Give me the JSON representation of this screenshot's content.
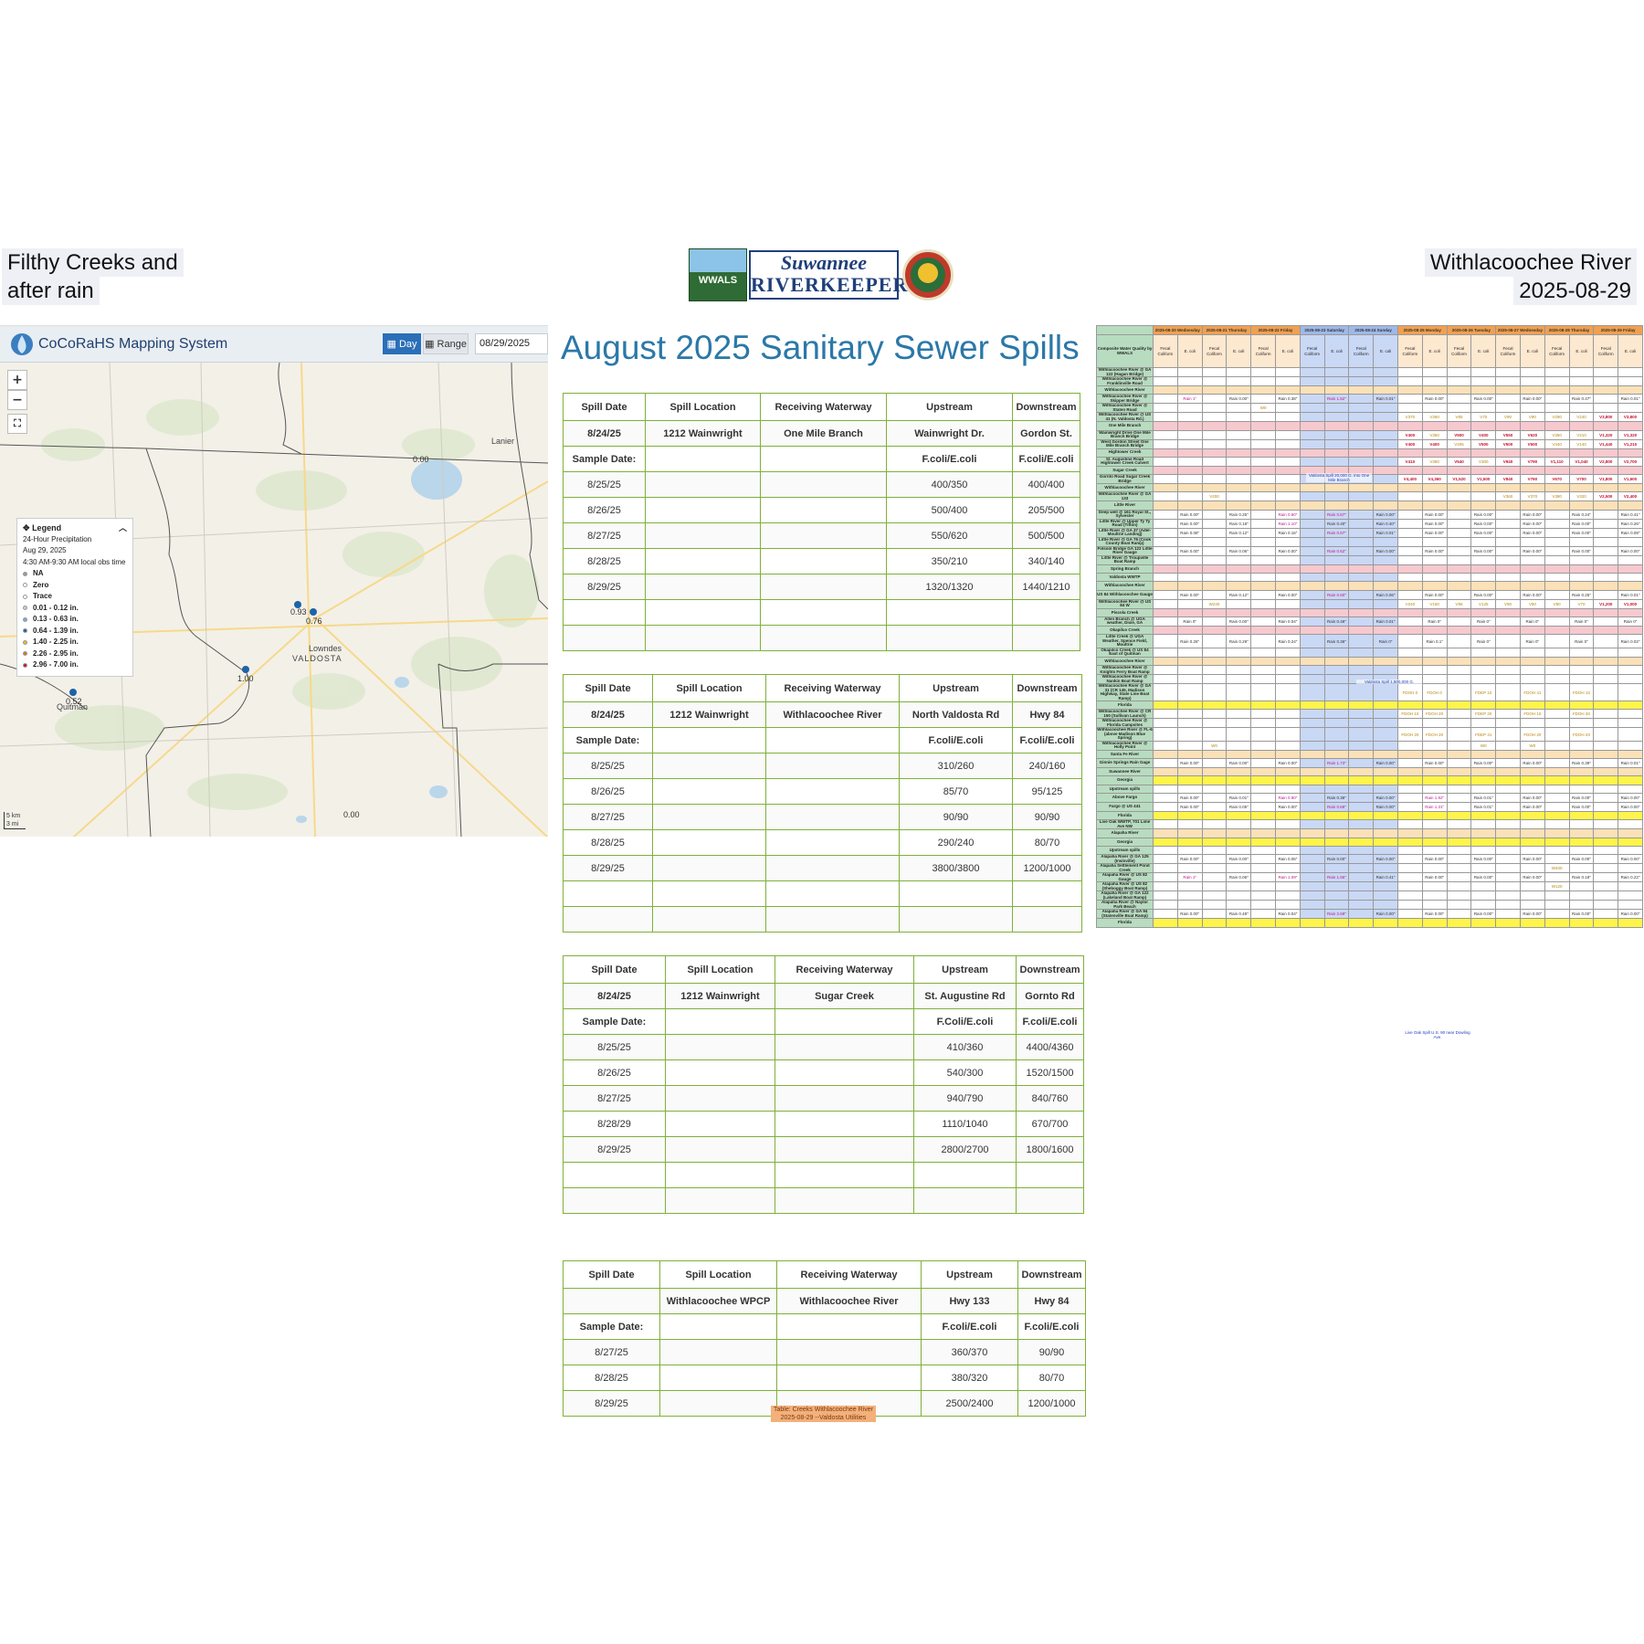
{
  "title_left": {
    "line1": "Filthy Creeks and",
    "line2": "after rain"
  },
  "title_right": {
    "line1": "Withlacoochee River",
    "line2": "2025-08-29"
  },
  "logos": {
    "wwals": "WWALS",
    "srk_line1": "Suwannee",
    "srk_line2": "RIVERKEEPER"
  },
  "map": {
    "app_title": "CoCoRaHS Mapping System",
    "day_label": "Day",
    "range_label": "Range",
    "date": "08/29/2025",
    "zoom_in": "+",
    "zoom_out": "−",
    "legend": {
      "title": "Legend",
      "subtitle": "24-Hour Precipitation",
      "date": "Aug 29, 2025",
      "time": "4:30 AM-9:30 AM local obs time",
      "items": [
        {
          "label": "NA",
          "color": "#999999"
        },
        {
          "label": "Zero",
          "color": "#ffffff"
        },
        {
          "label": "Trace",
          "color": "#ffffff"
        },
        {
          "label": "0.01 - 0.12 in.",
          "color": "#cccccc"
        },
        {
          "label": "0.13 - 0.63 in.",
          "color": "#6aaee8"
        },
        {
          "label": "0.64 - 1.39 in.",
          "color": "#1d63a8"
        },
        {
          "label": "1.40 - 2.25 in.",
          "color": "#e0c020"
        },
        {
          "label": "2.26 - 2.95 in.",
          "color": "#e07020"
        },
        {
          "label": "2.96 - 7.00 in.",
          "color": "#d01818"
        }
      ]
    },
    "places": {
      "lanier": "Lanier",
      "lowndes": "Lowndes",
      "valdosta": "VALDOSTA",
      "quitman": "Quitman"
    },
    "values": [
      "0.00",
      "0.93",
      "0.76",
      "1.00",
      "0.52",
      "0.00"
    ],
    "scale": {
      "km": "5 km",
      "mi": "3 mi"
    }
  },
  "main_title": "August 2025 Sanitary Sewer Spills",
  "headers": [
    "Spill Date",
    "Spill Location",
    "Receiving Waterway",
    "Upstream",
    "Downstream"
  ],
  "sample_label": "Sample Date:",
  "spills": [
    {
      "info": [
        "8/24/25",
        "1212 Wainwright",
        "One Mile Branch",
        "Wainwright Dr.",
        "Gordon St."
      ],
      "units": [
        "F.coli/E.coli",
        "F.coli/E.coli"
      ],
      "rows": [
        [
          "8/25/25",
          "400/350",
          "400/400"
        ],
        [
          "8/26/25",
          "500/400",
          "205/500"
        ],
        [
          "8/27/25",
          "550/620",
          "500/500"
        ],
        [
          "8/28/25",
          "350/210",
          "340/140"
        ],
        [
          "8/29/25",
          "1320/1320",
          "1440/1210"
        ]
      ],
      "blank": 2
    },
    {
      "info": [
        "8/24/25",
        "1212 Wainwright",
        "Withlacoochee River",
        "North Valdosta Rd",
        "Hwy 84"
      ],
      "units": [
        "F.coli/E.coli",
        "F.coli/E.coli"
      ],
      "rows": [
        [
          "8/25/25",
          "310/260",
          "240/160"
        ],
        [
          "8/26/25",
          "85/70",
          "95/125"
        ],
        [
          "8/27/25",
          "90/90",
          "90/90"
        ],
        [
          "8/28/25",
          "290/240",
          "80/70"
        ],
        [
          "8/29/25",
          "3800/3800",
          "1200/1000"
        ]
      ],
      "blank": 2
    },
    {
      "info": [
        "8/24/25",
        "1212 Wainwright",
        "Sugar Creek",
        "St. Augustine Rd",
        "Gornto Rd"
      ],
      "units": [
        "F.Coli/E.coli",
        "F.coli/E.coli"
      ],
      "rows": [
        [
          "8/25/25",
          "410/360",
          "4400/4360"
        ],
        [
          "8/26/25",
          "540/300",
          "1520/1500"
        ],
        [
          "8/27/25",
          "940/790",
          "840/760"
        ],
        [
          "8/28/29",
          "1110/1040",
          "670/700"
        ],
        [
          "8/29/25",
          "2800/2700",
          "1800/1600"
        ]
      ],
      "blank": 2
    },
    {
      "info": [
        "",
        "Withlacoochee WPCP",
        "Withlacoochee River",
        "Hwy 133",
        "Hwy 84"
      ],
      "units": [
        "F.coli/E.coli",
        "F.coli/E.coli"
      ],
      "rows": [
        [
          "8/27/25",
          "360/370",
          "90/90"
        ],
        [
          "8/28/25",
          "380/320",
          "80/70"
        ],
        [
          "8/29/25",
          "2500/2400",
          "1200/1000"
        ]
      ],
      "blank": 0
    }
  ],
  "caption": {
    "line1": "Table: Creeks Withlacoochee River",
    "line2": "2025-08-29 --Valdosta Utilities"
  },
  "sheet": {
    "dates": [
      "2025-08-20",
      "2025-08-21",
      "2025-08-22",
      "2025-08-23",
      "2025-08-24",
      "2025-08-25",
      "2025-08-26",
      "2025-08-27",
      "2025-08-28",
      "2025-08-29"
    ],
    "days": [
      "Wednesday",
      "Thursday",
      "Friday",
      "Saturday",
      "Sunday",
      "Monday",
      "Tuesday",
      "Wednesday",
      "Thursday",
      "Friday"
    ],
    "corner": "Composite Water Quality by WWALS",
    "fecal": "Fecal Coliform",
    "ecoli": "E. coli",
    "rows": [
      {
        "loc": "Withlacoochee River @ GA 122 (Hagan Bridge)",
        "cls": ""
      },
      {
        "loc": "Withlacoochee River @ Franklinville Road",
        "cls": ""
      },
      {
        "loc": "Withlacoochee River",
        "cls": "r-tan"
      },
      {
        "loc": "Withlacoochee River @ Skipper Bridge",
        "cls": "",
        "v": {
          "1": "Rain 1\"",
          "3": "Rain 0.00\"",
          "5": "Rain 0.38\"",
          "7": "Rain 1.52\"",
          "9": "Rain 0.01\"",
          "11": "Rain 0.00\"",
          "13": "Rain 0.00\"",
          "15": "Rain 0.00\"",
          "17": "Rain 0.47\"",
          "19": "Rain 0.01\""
        }
      },
      {
        "loc": "Withlacoochee River @ Staten Road",
        "cls": "",
        "v": {
          "4": "W0"
        }
      },
      {
        "loc": "Withlacoochee River @ US 41 (N. Valdosta Rd.)",
        "cls": "",
        "v": {
          "10": "V370",
          "11": "V260",
          "12": "V85",
          "13": "V70",
          "14": "V90",
          "15": "V90",
          "16": "V290",
          "17": "V240",
          "18": "V3,800",
          "19": "V3,800"
        }
      },
      {
        "loc": "One Mile Branch",
        "cls": "r-pink"
      },
      {
        "loc": "Wainwright Drive One Mile Branch Bridge",
        "cls": "",
        "v": {
          "10": "V400",
          "11": "V350",
          "12": "V500",
          "13": "V400",
          "14": "V550",
          "15": "V620",
          "16": "V350",
          "17": "V210",
          "18": "V1,320",
          "19": "V1,320"
        }
      },
      {
        "loc": "West Gordon Street One Mile Branch Bridge",
        "cls": "",
        "v": {
          "10": "V400",
          "11": "V400",
          "12": "V205",
          "13": "V500",
          "14": "V500",
          "15": "V500",
          "16": "V340",
          "17": "V140",
          "18": "V1,440",
          "19": "V1,210"
        }
      },
      {
        "loc": "Hightower Creek",
        "cls": "r-pink"
      },
      {
        "loc": "St. Augustine Road Hightower Creek Culvert",
        "cls": "",
        "v": {
          "10": "V410",
          "11": "V360",
          "12": "V540",
          "13": "V300",
          "14": "V940",
          "15": "V790",
          "16": "V1,110",
          "17": "V1,040",
          "18": "V2,800",
          "19": "V2,700"
        }
      },
      {
        "loc": "Sugar Creek",
        "cls": "r-pink"
      },
      {
        "loc": "Gornto Road Sugar Creek Bridge",
        "cls": "",
        "v": {
          "10": "V4,400",
          "11": "V4,360",
          "12": "V1,520",
          "13": "V1,500",
          "14": "V840",
          "15": "V760",
          "16": "V670",
          "17": "V700",
          "18": "V1,800",
          "19": "V1,600"
        }
      },
      {
        "loc": "Withlacoochee River",
        "cls": "r-tan"
      },
      {
        "loc": "Withlacoochee River @ GA 133",
        "cls": "",
        "v": {
          "2": "V200",
          "14": "V360",
          "15": "V370",
          "16": "V380",
          "17": "V320",
          "18": "V2,500",
          "19": "V2,400"
        }
      },
      {
        "loc": "Little River",
        "cls": "r-tan"
      },
      {
        "loc": "Deep well @ 161 Royal St., Sylvester",
        "cls": "",
        "v": {
          "1": "Rain 0.00\"",
          "3": "Rain 0.25\"",
          "5": "Rain 0.60\"",
          "7": "Rain 0.67\"",
          "9": "Rain 0.00\"",
          "11": "Rain 0.00\"",
          "13": "Rain 0.00\"",
          "15": "Rain 0.00\"",
          "17": "Rain 0.24\"",
          "19": "Rain 0.41\""
        }
      },
      {
        "loc": "Little River @ Upper Ty Ty Road (Tifton)",
        "cls": "",
        "v": {
          "1": "Rain 0.00\"",
          "3": "Rain 0.18\"",
          "5": "Rain 1.10\"",
          "7": "Rain 0.40\"",
          "9": "Rain 0.40\"",
          "11": "Rain 0.00\"",
          "13": "Rain 0.00\"",
          "15": "Rain 0.00\"",
          "17": "Rain 0.00\"",
          "19": "Rain 0.26\""
        }
      },
      {
        "loc": "Little River @ GA 37 (Adel-Moultrie Landing)",
        "cls": "",
        "v": {
          "1": "Rain 0.08\"",
          "3": "Rain 0.12\"",
          "5": "Rain 0.16\"",
          "7": "Rain 0.67\"",
          "9": "Rain 0.01\"",
          "11": "Rain 0.00\"",
          "13": "Rain 0.00\"",
          "15": "Rain 0.00\"",
          "17": "Rain 0.00\"",
          "19": "Rain 0.08\""
        }
      },
      {
        "loc": "Little River @ GA 76 (Cook County Boat Ramp)",
        "cls": ""
      },
      {
        "loc": "Folsom Bridge GA 122 Little River Gauge",
        "cls": "",
        "v": {
          "1": "Rain 0.00\"",
          "3": "Rain 0.06\"",
          "5": "Rain 0.00\"",
          "7": "Rain 0.62\"",
          "9": "Rain 0.00\"",
          "11": "Rain 0.00\"",
          "13": "Rain 0.00\"",
          "15": "Rain 0.00\"",
          "17": "Rain 0.00\"",
          "19": "Rain 0.00\""
        }
      },
      {
        "loc": "Little River @ Troupville Boat Ramp",
        "cls": ""
      },
      {
        "loc": "Spring Branch",
        "cls": "r-pink"
      },
      {
        "loc": "Valdosta WWTP",
        "cls": ""
      },
      {
        "loc": "Withlacoochee River",
        "cls": "r-tan"
      },
      {
        "loc": "US 84 Withlacoochee Gauge",
        "cls": "",
        "v": {
          "1": "Rain 0.00\"",
          "3": "Rain 0.12\"",
          "5": "Rain 0.00\"",
          "7": "Rain 0.60\"",
          "9": "Rain 0.06\"",
          "11": "Rain 0.00\"",
          "13": "Rain 0.00\"",
          "15": "Rain 0.00\"",
          "17": "Rain 0.25\"",
          "19": "Rain 0.01\""
        }
      },
      {
        "loc": "Withlacoochee River @ US 84 W",
        "cls": "",
        "v": {
          "2": "W240",
          "10": "V240",
          "11": "V160",
          "12": "V95",
          "13": "V125",
          "14": "V90",
          "15": "V90",
          "16": "V80",
          "17": "V70",
          "18": "V1,200",
          "19": "V1,000"
        }
      },
      {
        "loc": "Piscola Creek",
        "cls": "r-pink"
      },
      {
        "loc": "Allen Branch @ UGA weather, Dixie, GA",
        "cls": "",
        "v": {
          "1": "Rain 0\"",
          "3": "Rain 0.00\"",
          "5": "Rain 0.04\"",
          "7": "Rain 0.46\"",
          "9": "Rain 0.01\"",
          "11": "Rain 0\"",
          "13": "Rain 0\"",
          "15": "Rain 0\"",
          "17": "Rain 0\"",
          "19": "Rain 0\""
        }
      },
      {
        "loc": "Okapilco Creek",
        "cls": "r-pink"
      },
      {
        "loc": "Little Creek @ UGA Weather, Spence Field, Moultrie",
        "cls": "",
        "v": {
          "1": "Rain 0.26\"",
          "3": "Rain 0.29\"",
          "5": "Rain 0.24\"",
          "7": "Rain 0.36\"",
          "9": "Rain 0\"",
          "11": "Rain 0.1\"",
          "13": "Rain 0\"",
          "15": "Rain 0\"",
          "17": "Rain 0\"",
          "19": "Rain 0.02\""
        }
      },
      {
        "loc": "Okapilco Creek @ US 84 East of Quitman",
        "cls": ""
      },
      {
        "loc": "Withlacoochee River",
        "cls": "r-tan"
      },
      {
        "loc": "Withlacoochee River @ Knights Ferry Boat Ramp",
        "cls": ""
      },
      {
        "loc": "Withlacoochee River @ Nankin Boat Ramp",
        "cls": ""
      },
      {
        "loc": "Withlacoochee River @ GA 31 (CR 145, Madison Highway, State Line Boat Ramp)",
        "cls": "",
        "v": {
          "10": "FDOH 0",
          "11": "FDOH 0",
          "13": "FDEP 10",
          "15": "FDOH 41",
          "17": "FDOH 10"
        }
      },
      {
        "loc": "Florida",
        "cls": "r-yellow"
      },
      {
        "loc": "Withlacoochee River @ CR 150 (Sullivan Launch)",
        "cls": "",
        "v": {
          "10": "FDOH 10",
          "11": "FDOH 20",
          "13": "FDEP 20",
          "15": "FDOH 10",
          "17": "FDOH 30"
        }
      },
      {
        "loc": "Withlacoochee River @ Florida Campsites",
        "cls": ""
      },
      {
        "loc": "Withlacoochee River @ FL-6 (above Madison Blue Spring)",
        "cls": "",
        "v": {
          "10": "FDOH 20",
          "11": "FDOH 20",
          "13": "FDEP 31",
          "15": "FDOH 20",
          "17": "FDOH 20"
        }
      },
      {
        "loc": "Withlacoochee River @ Holly Point",
        "cls": "",
        "v": {
          "2": "W0",
          "13": "W0",
          "15": "W0"
        }
      },
      {
        "loc": "Santa Fe River",
        "cls": "r-tan"
      },
      {
        "loc": "Ginnie Springs Rain Gage",
        "cls": "",
        "v": {
          "1": "Rain 0.00\"",
          "3": "Rain 0.00\"",
          "5": "Rain 0.00\"",
          "7": "Rain 1.73\"",
          "9": "Rain 0.00\"",
          "11": "Rain 0.00\"",
          "13": "Rain 0.00\"",
          "15": "Rain 0.00\"",
          "17": "Rain 0.39\"",
          "19": "Rain 0.01\""
        }
      },
      {
        "loc": "Suwannee River",
        "cls": "r-tan"
      },
      {
        "loc": "Georgia",
        "cls": "r-yellow"
      },
      {
        "loc": "Upstream spills",
        "cls": ""
      },
      {
        "loc": "Above Fargo",
        "cls": "",
        "v": {
          "1": "Rain 0.00\"",
          "3": "Rain 0.01\"",
          "5": "Rain 0.90\"",
          "7": "Rain 0.36\"",
          "9": "Rain 0.00\"",
          "11": "Rain 1.92\"",
          "13": "Rain 0.01\"",
          "15": "Rain 0.00\"",
          "17": "Rain 0.00\"",
          "19": "Rain 0.00\""
        }
      },
      {
        "loc": "Fargo @ US 441",
        "cls": "",
        "v": {
          "1": "Rain 0.00\"",
          "3": "Rain 0.05\"",
          "5": "Rain 0.00\"",
          "7": "Rain 0.69\"",
          "9": "Rain 0.00\"",
          "11": "Rain 1.31\"",
          "13": "Rain 0.01\"",
          "15": "Rain 0.00\"",
          "17": "Rain 0.00\"",
          "19": "Rain 0.00\""
        }
      },
      {
        "loc": "Florida",
        "cls": "r-yellow"
      },
      {
        "loc": "Live Oak WWTP, 701 Lime Ave NW",
        "cls": ""
      },
      {
        "loc": "Alapaha River",
        "cls": "r-tan"
      },
      {
        "loc": "Georgia",
        "cls": "r-yellow"
      },
      {
        "loc": "Upstream spills",
        "cls": ""
      },
      {
        "loc": "Alapaha River @ GA 125 (Irwinville)",
        "cls": "",
        "v": {
          "1": "Rain 0.00\"",
          "3": "Rain 0.00\"",
          "5": "Rain 0.06\"",
          "7": "Rain 0.00\"",
          "9": "Rain 0.00\"",
          "11": "Rain 0.00\"",
          "13": "Rain 0.00\"",
          "15": "Rain 0.00\"",
          "17": "Rain 0.00\"",
          "19": "Rain 0.00\""
        }
      },
      {
        "loc": "Alapaha Settlement Pond Creek",
        "cls": "",
        "v": {
          "16": "W400"
        }
      },
      {
        "loc": "Alapaha River @ US 82 Gauge",
        "cls": "",
        "v": {
          "1": "Rain 1\"",
          "3": "Rain 0.06\"",
          "5": "Rain 1.09\"",
          "7": "Rain 1.55\"",
          "9": "Rain 0.41\"",
          "11": "Rain 0.00\"",
          "13": "Rain 0.00\"",
          "15": "Rain 0.00\"",
          "17": "Rain 0.18\"",
          "19": "Rain 0.22\""
        }
      },
      {
        "loc": "Alapaha River @ US 82 (Sheboggy Boat Ramp)",
        "cls": "",
        "v": {
          "16": "W120"
        }
      },
      {
        "loc": "Alapaha River @ GA 122 (Lakeland Boat Ramp)",
        "cls": ""
      },
      {
        "loc": "Alapaha River @ Naylor Park Beach",
        "cls": ""
      },
      {
        "loc": "Alapaha River @ GA 94 (Statenville Boat Ramp)",
        "cls": "",
        "v": {
          "1": "Rain 0.00\"",
          "3": "Rain 0.48\"",
          "5": "Rain 0.04\"",
          "7": "Rain 2.69\"",
          "9": "Rain 0.00\"",
          "11": "Rain 0.00\"",
          "13": "Rain 0.00\"",
          "15": "Rain 0.00\"",
          "17": "Rain 0.00\"",
          "19": "Rain 0.00\""
        }
      },
      {
        "loc": "Florida",
        "cls": "r-yellow"
      }
    ],
    "notes": {
      "valdosta_spill": "Valdosta Spill 20,000 G. into One Mile Branch",
      "valdosta_spill2": "Valdosta Spill 1,500,000 G.",
      "live_oak": "Live Oak Spill U.S. 90 near Dowling Ave."
    }
  }
}
